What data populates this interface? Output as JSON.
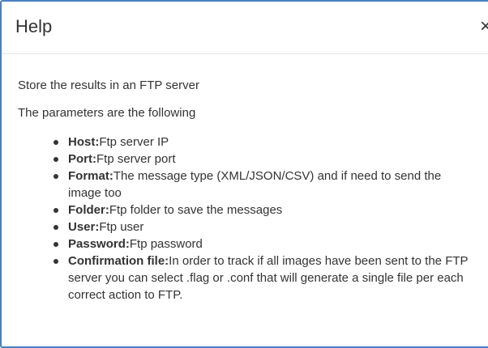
{
  "dialog": {
    "title": "Help",
    "close_glyph": "×"
  },
  "body": {
    "intro": "Store the results in an FTP server",
    "subtitle": "The parameters are the following",
    "params": [
      {
        "name": "Host:",
        "desc": "Ftp server IP"
      },
      {
        "name": "Port:",
        "desc": "Ftp server port"
      },
      {
        "name": "Format:",
        "desc": "The message type (XML/JSON/CSV) and if need to send the image too"
      },
      {
        "name": "Folder:",
        "desc": "Ftp folder to save the messages"
      },
      {
        "name": "User:",
        "desc": "Ftp user"
      },
      {
        "name": "Password:",
        "desc": "Ftp password"
      },
      {
        "name": "Confirmation file:",
        "desc": "In order to track if all images have been sent to the FTP server you can select .flag or .conf that will generate a single file per each correct action to FTP."
      }
    ]
  },
  "colors": {
    "border": "#4a7fc4",
    "text": "#333333",
    "divider": "#e5e5e5"
  },
  "icons": {
    "close": "close-icon",
    "bullet": "bullet-icon"
  }
}
